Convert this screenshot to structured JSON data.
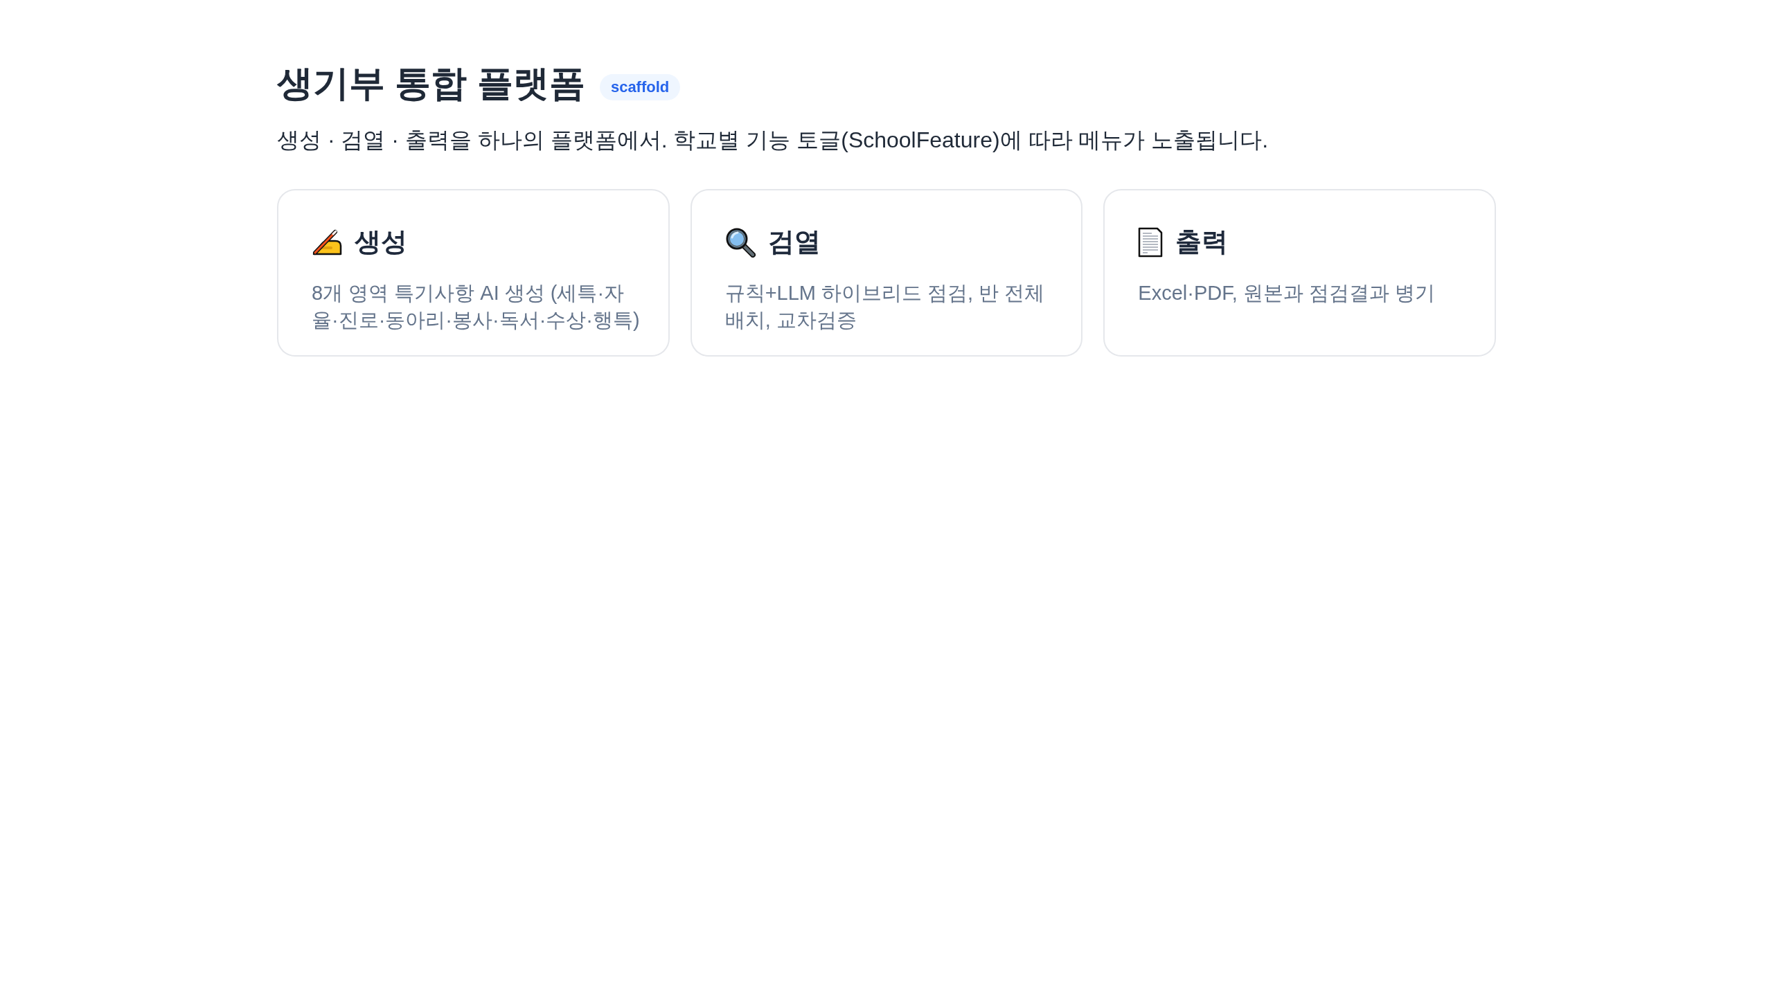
{
  "header": {
    "title": "생기부 통합 플랫폼",
    "badge": "scaffold",
    "subtitle": "생성 · 검열 · 출력을 하나의 플랫폼에서. 학교별 기능 토글(SchoolFeature)에 따라 메뉴가 노출됩니다."
  },
  "cards": [
    {
      "title": "생성",
      "description": "8개 영역 특기사항 AI 생성 (세특·자율·진로·동아리·봉사·독서·수상·행특)"
    },
    {
      "title": "검열",
      "description": "규칙+LLM 하이브리드 점검, 반 전체 배치, 교차검증"
    },
    {
      "title": "출력",
      "description": "Excel·PDF, 원본과 점검결과 병기"
    }
  ]
}
